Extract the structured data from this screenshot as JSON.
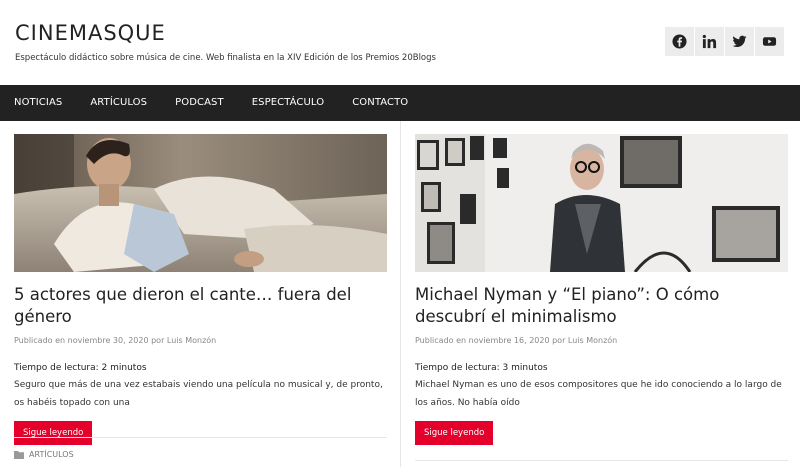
{
  "site": {
    "title": "CINEMASQUE",
    "description": "Espectáculo didáctico sobre música de cine. Web finalista en la XIV Edición de los Premios 20Blogs"
  },
  "social": [
    {
      "icon": "facebook-icon"
    },
    {
      "icon": "linkedin-icon"
    },
    {
      "icon": "twitter-icon"
    },
    {
      "icon": "youtube-icon"
    }
  ],
  "nav": [
    {
      "label": "NOTICIAS"
    },
    {
      "label": "ARTÍCULOS"
    },
    {
      "label": "PODCAST"
    },
    {
      "label": "ESPECTÁCULO"
    },
    {
      "label": "CONTACTO"
    }
  ],
  "posts": [
    {
      "title": "5 actores que dieron el cante… fuera del género",
      "meta": "Publicado en noviembre 30, 2020 por Luis Monzón",
      "read_time": "Tiempo de lectura: 2 minutos",
      "excerpt": "Seguro que más de una vez estabais viendo una película no musical y, de pronto, os habéis topado con una",
      "button": "Sigue leyendo",
      "category": "ARTÍCULOS"
    },
    {
      "title": "Michael Nyman y “El piano”: O cómo descubrí el minimalismo",
      "meta": "Publicado en noviembre 16, 2020 por Luis Monzón",
      "read_time": "Tiempo de lectura: 3 minutos",
      "excerpt": "Michael Nyman es uno de esos compositores que he ido conociendo a lo largo de los años. No había oído",
      "button": "Sigue leyendo"
    }
  ],
  "colors": {
    "nav_bg": "#222222",
    "accent": "#e4002b",
    "social_bg": "#ececec"
  }
}
